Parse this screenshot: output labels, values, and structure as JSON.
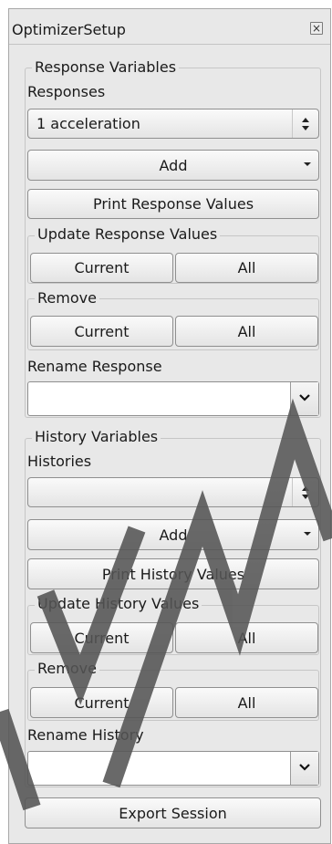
{
  "window": {
    "title": "OptimizerSetup",
    "close_icon": "close-icon"
  },
  "response": {
    "group_title": "Response Variables",
    "list_label": "Responses",
    "selected": "1 acceleration",
    "add_label": "Add",
    "print_label": "Print Response Values",
    "update_title": "Update Response Values",
    "update_current": "Current",
    "update_all": "All",
    "remove_title": "Remove",
    "remove_current": "Current",
    "remove_all": "All",
    "rename_label": "Rename Response",
    "rename_value": ""
  },
  "history": {
    "group_title": "History Variables",
    "list_label": "Histories",
    "selected": "",
    "add_label": "Add",
    "print_label": "Print History Values",
    "update_title": "Update History Values",
    "update_current": "Current",
    "update_all": "All",
    "remove_title": "Remove",
    "remove_current": "Current",
    "remove_all": "All",
    "rename_label": "Rename History",
    "rename_value": ""
  },
  "export_label": "Export Session",
  "watermark": {
    "color": "#555555"
  }
}
